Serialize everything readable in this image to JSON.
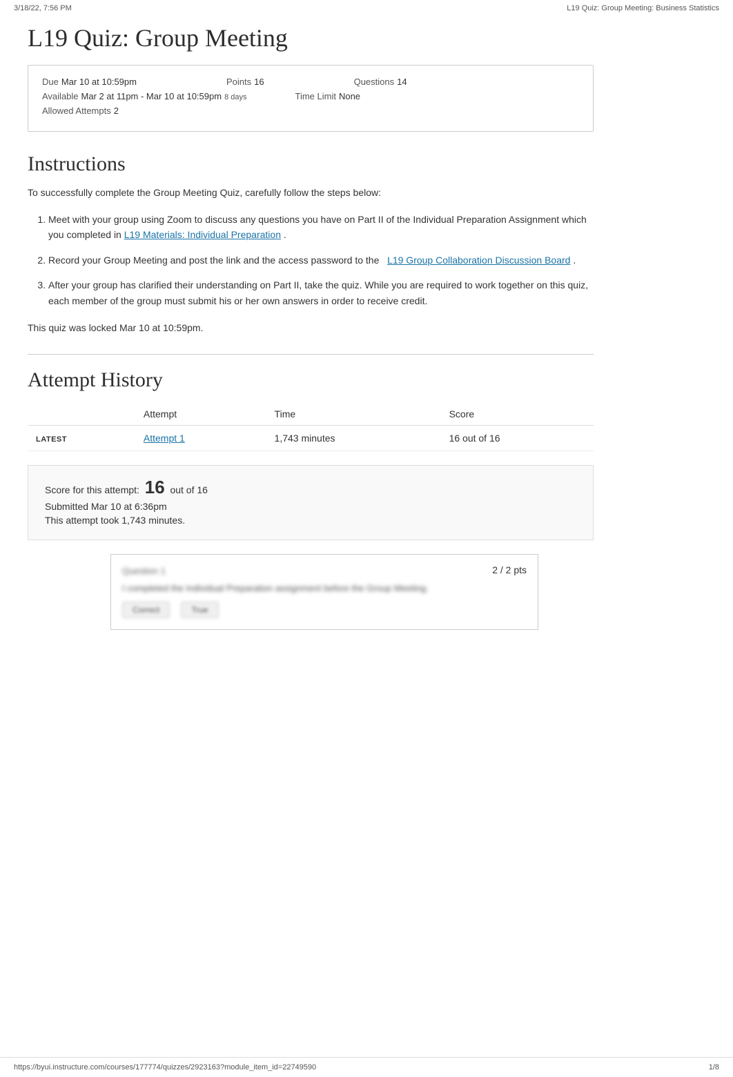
{
  "topbar": {
    "date_time": "3/18/22, 7:56 PM",
    "page_title": "L19 Quiz: Group Meeting: Business Statistics"
  },
  "quiz": {
    "title": "L19 Quiz: Group Meeting",
    "due_label": "Due",
    "due_value": "Mar 10 at 10:59pm",
    "points_label": "Points",
    "points_value": "16",
    "questions_label": "Questions",
    "questions_value": "14",
    "available_label": "Available",
    "available_value": "Mar 2 at 11pm - Mar 10 at 10:59pm",
    "available_days": "8 days",
    "time_limit_label": "Time Limit",
    "time_limit_value": "None",
    "allowed_attempts_label": "Allowed Attempts",
    "allowed_attempts_value": "2"
  },
  "instructions": {
    "section_title": "Instructions",
    "intro_text": "To successfully complete the Group Meeting Quiz, carefully follow the steps below:",
    "steps": [
      {
        "text_before": "Meet with your group using Zoom to discuss any questions you have on Part II of the Individual Preparation Assignment which you completed in",
        "link_text": "L19 Materials: Individual Preparation",
        "text_after": "."
      },
      {
        "text_before": "Record your Group Meeting and post the link and the access password to the",
        "link_text": "L19 Group Collaboration Discussion Board",
        "text_after": "."
      },
      {
        "text_before": "After your group has clarified their understanding on Part II, take the quiz. While you are required to work together on this quiz, each member of the group must submit his or her own answers in order to receive credit.",
        "link_text": "",
        "text_after": ""
      }
    ],
    "locked_text": "This quiz was locked Mar 10 at 10:59pm."
  },
  "attempt_history": {
    "section_title": "Attempt History",
    "columns": [
      "Attempt",
      "Time",
      "Score"
    ],
    "rows": [
      {
        "badge": "LATEST",
        "attempt_link": "Attempt 1",
        "time": "1,743 minutes",
        "score": "16 out of 16"
      }
    ]
  },
  "score_summary": {
    "score_label": "Score for this attempt:",
    "score_value": "16",
    "score_suffix": "out of 16",
    "submitted_text": "Submitted Mar 10 at 6:36pm",
    "duration_text": "This attempt took 1,743 minutes."
  },
  "question_block": {
    "points": "2 / 2 pts",
    "question_header": "Question 1",
    "question_text": "I completed the Individual Preparation assignment before the Group Meeting.",
    "answer_blurred": true
  },
  "footer": {
    "url": "https://byui.instructure.com/courses/177774/quizzes/2923163?module_item_id=22749590",
    "page": "1/8"
  }
}
